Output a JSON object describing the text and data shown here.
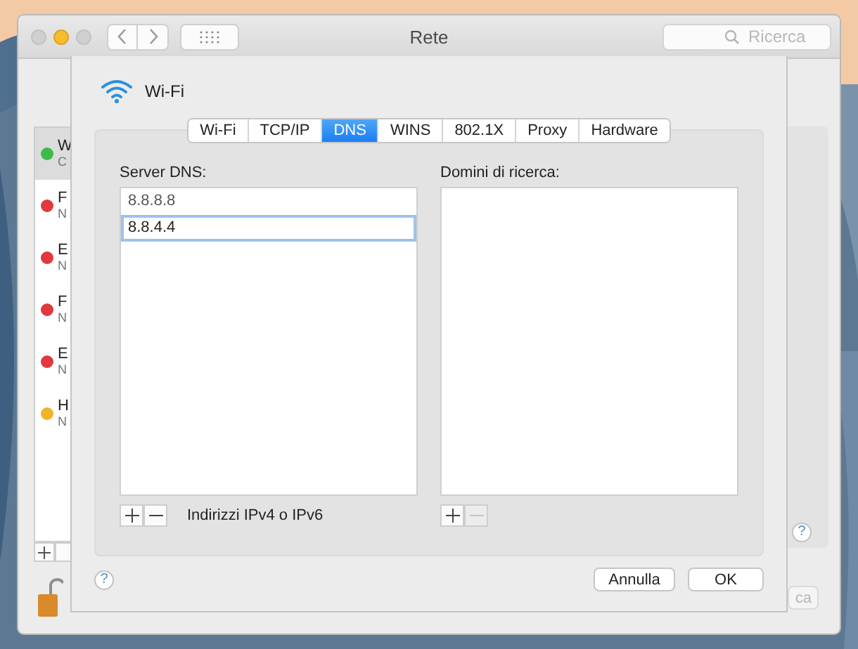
{
  "window": {
    "title": "Rete"
  },
  "search": {
    "placeholder": "Ricerca"
  },
  "services": [
    {
      "name": "W",
      "status": "C",
      "color": "#3dbb4a",
      "selected": true
    },
    {
      "name": "F",
      "status": "N",
      "color": "#e0393e",
      "selected": false
    },
    {
      "name": "E",
      "status": "N",
      "color": "#e0393e",
      "selected": false
    },
    {
      "name": "F",
      "status": "N",
      "color": "#e0393e",
      "selected": false
    },
    {
      "name": "E",
      "status": "N",
      "color": "#e0393e",
      "selected": false
    },
    {
      "name": "H",
      "status": "N",
      "color": "#f0b429",
      "selected": false
    }
  ],
  "sheet": {
    "title": "Wi-Fi",
    "tabs": [
      {
        "label": "Wi-Fi",
        "selected": false
      },
      {
        "label": "TCP/IP",
        "selected": false
      },
      {
        "label": "DNS",
        "selected": true
      },
      {
        "label": "WINS",
        "selected": false
      },
      {
        "label": "802.1X",
        "selected": false
      },
      {
        "label": "Proxy",
        "selected": false
      },
      {
        "label": "Hardware",
        "selected": false
      }
    ],
    "dns_servers": {
      "label": "Server DNS:",
      "entries": [
        {
          "value": "8.8.8.8",
          "selected": false
        },
        {
          "value": "8.8.4.4",
          "selected": true
        }
      ],
      "remove_disabled": false,
      "hint": "Indirizzi IPv4 o IPv6"
    },
    "search_domains": {
      "label": "Domini di ricerca:",
      "remove_disabled": true
    },
    "help": "?",
    "buttons": [
      {
        "label": "Annulla",
        "kind": "cancel"
      },
      {
        "label": "OK",
        "kind": "ok"
      }
    ]
  },
  "side_help": "?",
  "apply_button": {
    "label": "ca"
  }
}
